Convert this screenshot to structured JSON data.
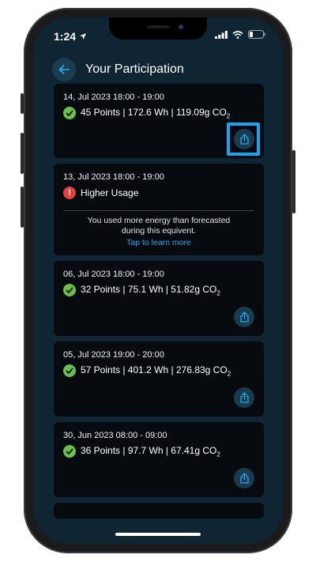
{
  "status": {
    "time": "1:24"
  },
  "header": {
    "title": "Your Participation"
  },
  "cards": [
    {
      "date": "14, Jul 2023 18:00 - 19:00",
      "status": "ok",
      "text": "45 Points | 172.6 Wh | 119.09g CO",
      "sub": "2",
      "highlighted": true
    },
    {
      "date": "13, Jul 2023 18:00 - 19:00",
      "status": "warn",
      "text": "Higher Usage",
      "message_line1": "You used more energy than forecasted",
      "message_line2": "during this equivent.",
      "link": "Tap to learn more"
    },
    {
      "date": "06, Jul 2023 18:00 - 19:00",
      "status": "ok",
      "text": "32 Points | 75.1 Wh | 51.82g CO",
      "sub": "2"
    },
    {
      "date": "05, Jul 2023 19:00 - 20:00",
      "status": "ok",
      "text": "57 Points | 401.2 Wh | 276.83g CO",
      "sub": "2"
    },
    {
      "date": "30, Jun 2023 08:00 - 09:00",
      "status": "ok",
      "text": "36 Points | 97.7 Wh | 67.41g CO",
      "sub": "2"
    }
  ],
  "colors": {
    "screen_bg": "#0f2533",
    "card_bg": "#070b0f",
    "accent": "#21a8e8",
    "ok": "#69c04a",
    "warn": "#e34040",
    "highlight": "#17a6ee"
  }
}
